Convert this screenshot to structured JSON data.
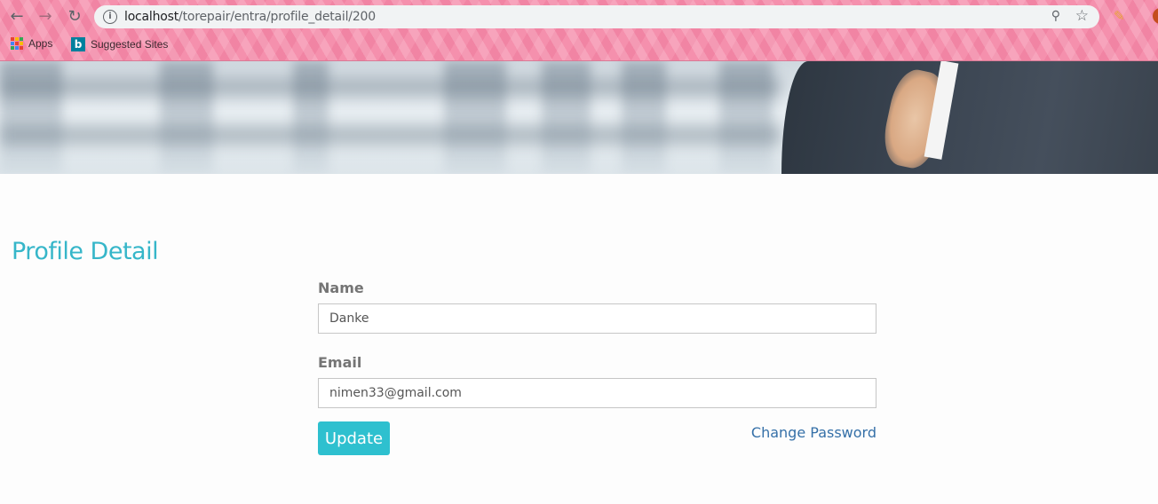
{
  "browser": {
    "url_host": "localhost",
    "url_path": "/torepair/entra/profile_detail/200",
    "bookmarks": [
      {
        "label": "Apps",
        "icon": "apps-grid-icon"
      },
      {
        "label": "Suggested Sites",
        "icon": "bing-icon"
      }
    ]
  },
  "page": {
    "title": "Profile Detail"
  },
  "form": {
    "name_label": "Name",
    "name_value": "Danke",
    "email_label": "Email",
    "email_value": "nimen33@gmail.com",
    "update_label": "Update",
    "change_password_label": "Change Password"
  },
  "colors": {
    "accent": "#36b6c9",
    "button": "#2ec0cf",
    "link": "#3570a8",
    "chrome": "#f590ad"
  }
}
